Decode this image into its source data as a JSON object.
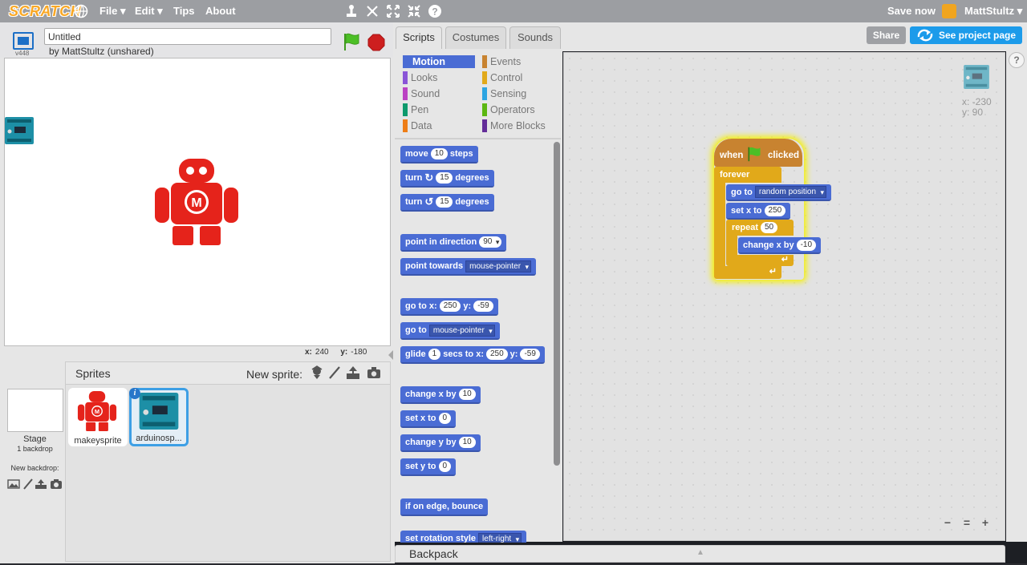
{
  "topbar": {
    "logo": "SCRATCH",
    "menu_file": "File ▾",
    "menu_edit": "Edit ▾",
    "menu_tips": "Tips",
    "menu_about": "About",
    "save_now": "Save now",
    "username": "MattStultz ▾",
    "share": "Share",
    "see_project": "See project page"
  },
  "stage": {
    "version": "v448",
    "title_value": "Untitled",
    "byline": "by MattStultz (unshared)",
    "mouse_x_label": "x:",
    "mouse_x": "240",
    "mouse_y_label": "y:",
    "mouse_y": "-180"
  },
  "sprites": {
    "header": "Sprites",
    "new_sprite": "New sprite:",
    "stage_label": "Stage",
    "stage_count": "1 backdrop",
    "new_backdrop": "New backdrop:",
    "items": [
      {
        "name": "makeysprite",
        "selected": false
      },
      {
        "name": "arduinosp...",
        "selected": true
      }
    ],
    "info_badge": "i"
  },
  "tabs": [
    "Scripts",
    "Costumes",
    "Sounds"
  ],
  "categories": [
    {
      "label": "Motion",
      "color": "#4a6cd4",
      "active": true
    },
    {
      "label": "Events",
      "color": "#c88330"
    },
    {
      "label": "Looks",
      "color": "#8a55d7"
    },
    {
      "label": "Control",
      "color": "#e1a91a"
    },
    {
      "label": "Sound",
      "color": "#bb42c3"
    },
    {
      "label": "Sensing",
      "color": "#2ca5e2"
    },
    {
      "label": "Pen",
      "color": "#0e9a6c"
    },
    {
      "label": "Operators",
      "color": "#5cb712"
    },
    {
      "label": "Data",
      "color": "#ee7d16"
    },
    {
      "label": "More Blocks",
      "color": "#632d99"
    }
  ],
  "palette": {
    "move": {
      "a": "move",
      "n": "10",
      "b": "steps"
    },
    "turn_right": {
      "a": "turn",
      "n": "15",
      "b": "degrees"
    },
    "turn_left": {
      "a": "turn",
      "n": "15",
      "b": "degrees"
    },
    "point_dir": {
      "a": "point in direction",
      "n": "90"
    },
    "point_towards": {
      "a": "point towards",
      "d": "mouse-pointer"
    },
    "goto_xy": {
      "a": "go to x:",
      "x": "250",
      "b": "y:",
      "y": "-59"
    },
    "goto": {
      "a": "go to",
      "d": "mouse-pointer"
    },
    "glide": {
      "a": "glide",
      "n": "1",
      "b": "secs to x:",
      "x": "250",
      "c": "y:",
      "y": "-59"
    },
    "change_x": {
      "a": "change x by",
      "n": "10"
    },
    "set_x": {
      "a": "set x to",
      "n": "0"
    },
    "change_y": {
      "a": "change y by",
      "n": "10"
    },
    "set_y": {
      "a": "set y to",
      "n": "0"
    },
    "bounce": {
      "a": "if on edge, bounce"
    },
    "rotation": {
      "a": "set rotation style",
      "d": "left-right"
    }
  },
  "script": {
    "hat_when": "when",
    "hat_clicked": "clicked",
    "forever": "forever",
    "goto_a": "go to",
    "goto_d": "random position",
    "setx_a": "set x to",
    "setx_n": "250",
    "repeat_a": "repeat",
    "repeat_n": "50",
    "changex_a": "change x by",
    "changex_n": "-10"
  },
  "script_area": {
    "sprite_x": "x: -230",
    "sprite_y": "y: 90",
    "help": "?"
  },
  "zoom": {
    "out": "−",
    "reset": "=",
    "in": "+"
  },
  "backpack": "Backpack"
}
